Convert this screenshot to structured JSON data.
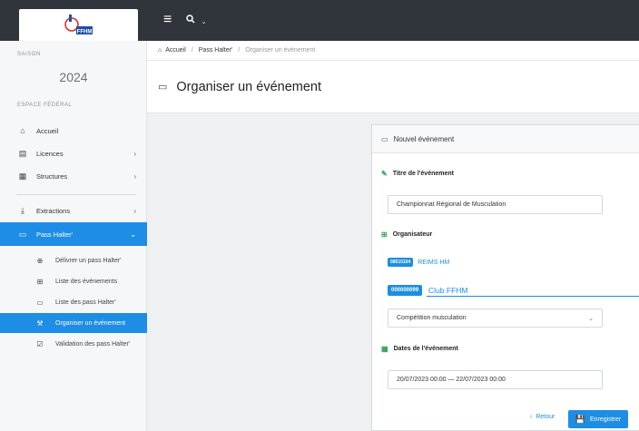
{
  "topbar": {
    "logo_text": "FFHM",
    "menu_icon": "hamburger-icon",
    "search_icon": "search-icon",
    "search_caret": "⌄"
  },
  "sidebar": {
    "season_caption": "SAISON",
    "season_year": "2024",
    "space_caption": "ESPACE FÉDÉRAL",
    "items": [
      {
        "label": "Accueil",
        "icon": "home-icon"
      },
      {
        "label": "Licences",
        "icon": "card-icon",
        "chevron": "›"
      },
      {
        "label": "Structures",
        "icon": "building-icon",
        "chevron": "›"
      },
      {
        "label": "Extractions",
        "icon": "download-icon",
        "chevron": "›"
      },
      {
        "label": "Pass Halter'",
        "icon": "barbell-icon",
        "chevron": "⌄"
      }
    ],
    "subitems": [
      {
        "label": "Délivrer un pass Halter'",
        "icon": "plus-circle-icon"
      },
      {
        "label": "Liste des événements",
        "icon": "list-icon"
      },
      {
        "label": "Liste des pass Halter'",
        "icon": "barbell-icon"
      },
      {
        "label": "Organiser un événement",
        "icon": "wrench-icon"
      },
      {
        "label": "Validation des pass Halter'",
        "icon": "check-card-icon"
      }
    ]
  },
  "breadcrumb": {
    "home": "Accueil",
    "level1": "Pass Halter'",
    "current": "Organiser un événement"
  },
  "page": {
    "title": "Organiser un événement"
  },
  "form": {
    "card_title": "Nouvel événement",
    "title_label": "Titre de l'événement",
    "title_value": "Championnat Régional de Musculation",
    "organizer_label": "Organisateur",
    "org1_code": "08510104",
    "org1_name": "REIMS HM",
    "org2_code": "000000099",
    "org2_name": "Club FFHM",
    "type_value": "Compétition musculation",
    "dates_label": "Dates de l'événement",
    "dates_value": "20/07/2023 00:00 — 22/07/2023 00:00",
    "back_label": "Retour",
    "save_label": "Enregistrer"
  },
  "colors": {
    "topbar": "#2f353a",
    "accent": "#1d8de5",
    "sidebar_bg": "#f6f7f8",
    "content_bg": "#eef0f2",
    "success": "#2ea44f"
  }
}
